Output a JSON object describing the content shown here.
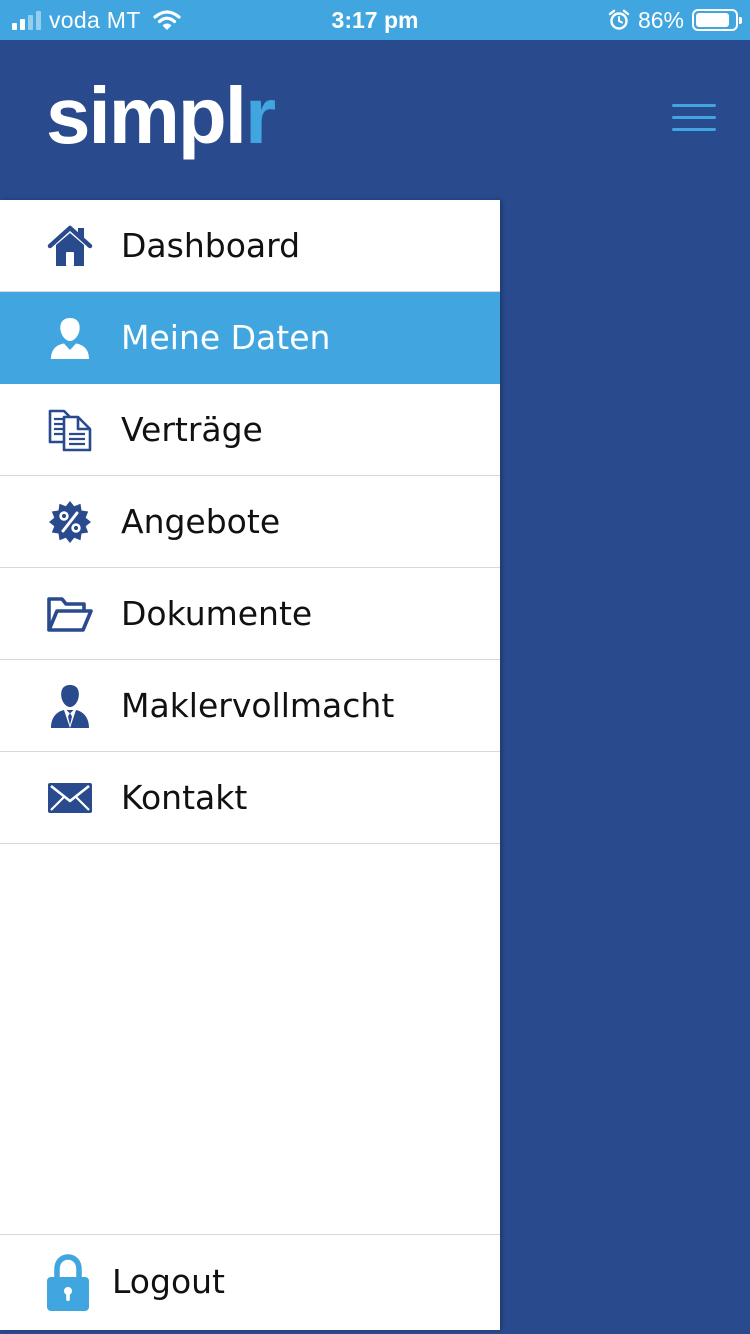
{
  "status_bar": {
    "carrier": "voda MT",
    "time": "3:17 pm",
    "battery_percent_text": "86%",
    "battery_level": 0.86
  },
  "header": {
    "logo_main": "simpl",
    "logo_accent": "r",
    "menu_icon": "hamburger-icon"
  },
  "colors": {
    "brand_dark": "#294a8d",
    "brand_light": "#41a6e0",
    "text": "#111111"
  },
  "menu": {
    "items": [
      {
        "label": "Dashboard",
        "icon": "house-icon",
        "active": false
      },
      {
        "label": "Meine Daten",
        "icon": "user-icon",
        "active": true
      },
      {
        "label": "Verträge",
        "icon": "documents-icon",
        "active": false
      },
      {
        "label": "Angebote",
        "icon": "percent-badge-icon",
        "active": false
      },
      {
        "label": "Dokumente",
        "icon": "folder-icon",
        "active": false
      },
      {
        "label": "Maklervollmacht",
        "icon": "broker-icon",
        "active": false
      },
      {
        "label": "Kontakt",
        "icon": "envelope-icon",
        "active": false
      }
    ],
    "logout": {
      "label": "Logout",
      "icon": "lock-icon"
    }
  }
}
